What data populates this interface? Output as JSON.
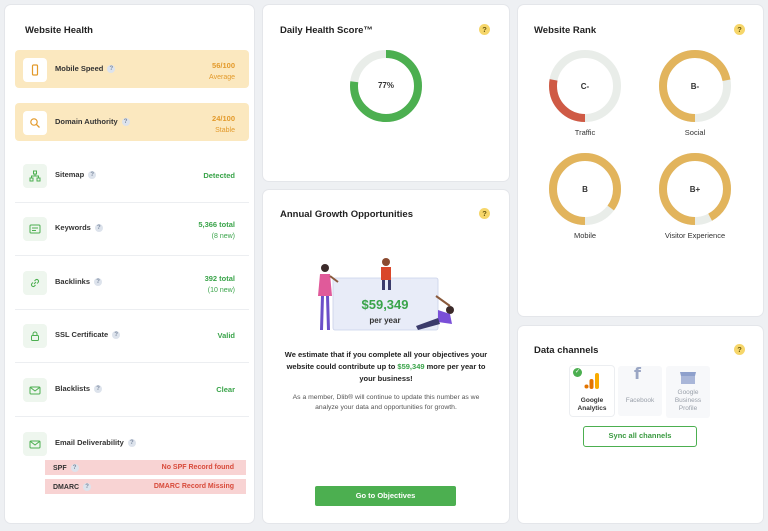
{
  "website_health": {
    "title": "Website Health",
    "help": "?",
    "rows": [
      {
        "label": "Mobile Speed",
        "value": "56/100",
        "sub": "Average"
      },
      {
        "label": "Domain Authority",
        "value": "24/100",
        "sub": "Stable"
      },
      {
        "label": "Sitemap",
        "value": "Detected"
      },
      {
        "label": "Keywords",
        "value": "5,366 total",
        "sub": "(8 new)"
      },
      {
        "label": "Backlinks",
        "value": "392 total",
        "sub": "(10 new)"
      },
      {
        "label": "SSL Certificate",
        "value": "Valid"
      },
      {
        "label": "Blacklists",
        "value": "Clear"
      },
      {
        "label": "Email Deliverability"
      }
    ],
    "email_checks": [
      {
        "label": "SPF",
        "value": "No SPF Record found"
      },
      {
        "label": "DMARC",
        "value": "DMARC Record Missing"
      }
    ]
  },
  "daily_health": {
    "title": "Daily Health Score™",
    "score_text": "77%",
    "score": 0.77,
    "color": "#4caf50"
  },
  "growth": {
    "title": "Annual Growth Opportunities",
    "amount": "$59,349",
    "per_year": "per year",
    "text_before": "We estimate that if you complete all your objectives your website could contribute up to ",
    "text_amount": "$59,349",
    "text_after": " more per year to your business!",
    "note": "As a member, Dlib® will continue to update this number as we analyze your data and opportunities for growth.",
    "button": "Go to Objectives"
  },
  "website_rank": {
    "title": "Website Rank",
    "ranks": [
      {
        "grade": "C-",
        "label": "Traffic",
        "fill": 0.28,
        "color": "#cf5a45"
      },
      {
        "grade": "B-",
        "label": "Social",
        "fill": 0.72,
        "color": "#e2b45c"
      },
      {
        "grade": "B",
        "label": "Mobile",
        "fill": 0.85,
        "color": "#e2b45c"
      },
      {
        "grade": "B+",
        "label": "Visitor Experience",
        "fill": 0.92,
        "color": "#e2b45c"
      }
    ]
  },
  "data_channels": {
    "title": "Data channels",
    "channels": [
      {
        "name": "Google Analytics",
        "connected": true,
        "icon": "google-analytics-icon"
      },
      {
        "name": "Facebook",
        "connected": false,
        "icon": "facebook-icon"
      },
      {
        "name": "Google Business Profile",
        "connected": false,
        "icon": "google-business-icon"
      }
    ],
    "button": "Sync all channels"
  },
  "colors": {
    "accent_green": "#4caf50",
    "warn_bg": "#fbe8bf",
    "alert_bg": "#f8d3d3",
    "track": "#e9ede9"
  }
}
